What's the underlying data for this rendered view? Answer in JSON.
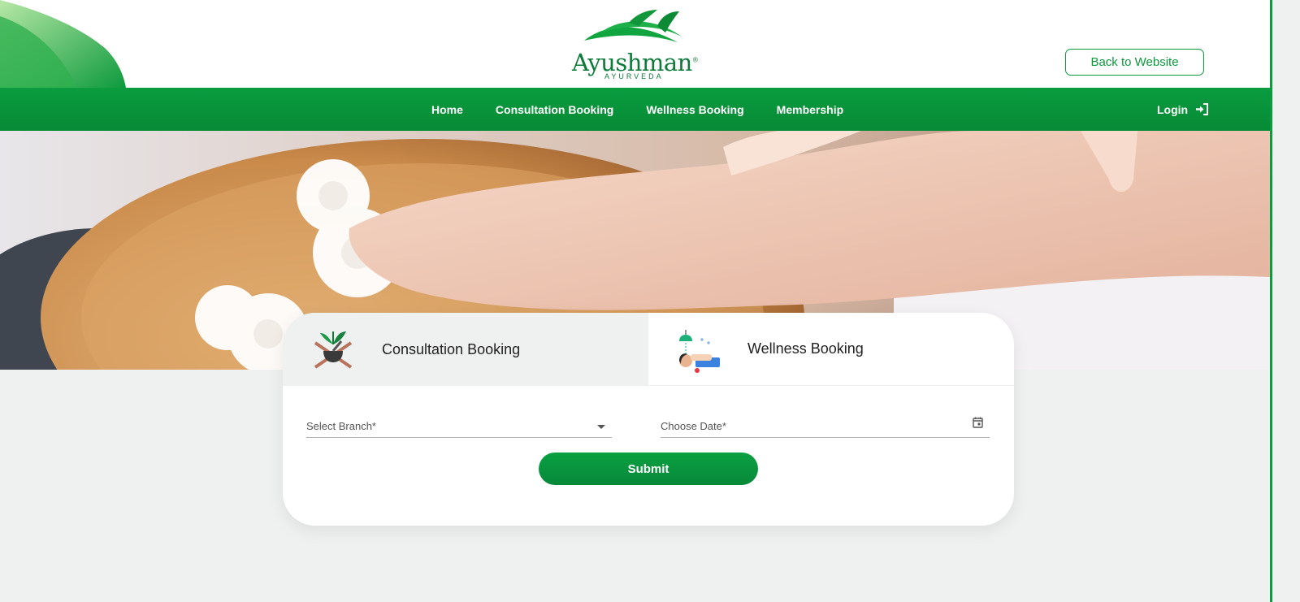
{
  "brand": {
    "name": "Ayushman",
    "registered": "®",
    "tagline": "AYURVEDA"
  },
  "header": {
    "back_label": "Back to Website"
  },
  "nav": {
    "items": [
      {
        "label": "Home"
      },
      {
        "label": "Consultation Booking"
      },
      {
        "label": "Wellness Booking"
      },
      {
        "label": "Membership"
      }
    ],
    "login_label": "Login"
  },
  "booking": {
    "tabs": [
      {
        "label": "Consultation Booking",
        "icon": "mortar-pestle-herb-icon",
        "active": true
      },
      {
        "label": "Wellness Booking",
        "icon": "shirodhara-therapy-icon",
        "active": false
      }
    ],
    "branch_label": "Select Branch*",
    "date_label": "Choose Date*",
    "submit_label": "Submit"
  },
  "colors": {
    "primary_green": "#0a9c3f",
    "page_bg": "#eff1f0",
    "tab_active_bg": "#eff1f0"
  }
}
